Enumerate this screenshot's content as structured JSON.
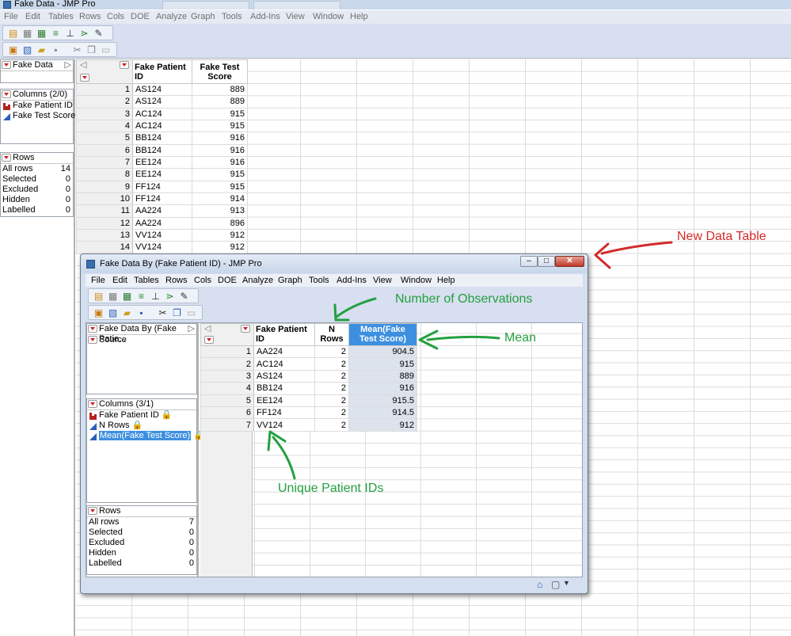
{
  "main_window": {
    "title": "Fake Data - JMP Pro",
    "menu": [
      "File",
      "Edit",
      "Tables",
      "Rows",
      "Cols",
      "DOE",
      "Analyze",
      "Graph",
      "Tools",
      "Add-Ins",
      "View",
      "Window",
      "Help"
    ],
    "table_panel_title": "Fake Data",
    "columns_panel_title": "Columns (2/0)",
    "columns": [
      {
        "name": "Fake Patient ID",
        "type": "nominal"
      },
      {
        "name": "Fake Test Score",
        "type": "continuous"
      }
    ],
    "rows_panel_title": "Rows",
    "rows_summary": [
      {
        "label": "All rows",
        "value": "14"
      },
      {
        "label": "Selected",
        "value": "0"
      },
      {
        "label": "Excluded",
        "value": "0"
      },
      {
        "label": "Hidden",
        "value": "0"
      },
      {
        "label": "Labelled",
        "value": "0"
      }
    ],
    "grid_headers": [
      "Fake Patient ID",
      "Fake Test Score"
    ],
    "grid_rows": [
      {
        "n": "1",
        "id": "AS124",
        "score": "889"
      },
      {
        "n": "2",
        "id": "AS124",
        "score": "889"
      },
      {
        "n": "3",
        "id": "AC124",
        "score": "915"
      },
      {
        "n": "4",
        "id": "AC124",
        "score": "915"
      },
      {
        "n": "5",
        "id": "BB124",
        "score": "916"
      },
      {
        "n": "6",
        "id": "BB124",
        "score": "916"
      },
      {
        "n": "7",
        "id": "EE124",
        "score": "916"
      },
      {
        "n": "8",
        "id": "EE124",
        "score": "915"
      },
      {
        "n": "9",
        "id": "FF124",
        "score": "915"
      },
      {
        "n": "10",
        "id": "FF124",
        "score": "914"
      },
      {
        "n": "11",
        "id": "AA224",
        "score": "913"
      },
      {
        "n": "12",
        "id": "AA224",
        "score": "896"
      },
      {
        "n": "13",
        "id": "VV124",
        "score": "912"
      },
      {
        "n": "14",
        "id": "VV124",
        "score": "912"
      }
    ]
  },
  "child_window": {
    "title": "Fake Data By (Fake Patient ID) - JMP Pro",
    "menu": [
      "File",
      "Edit",
      "Tables",
      "Rows",
      "Cols",
      "DOE",
      "Analyze",
      "Graph",
      "Tools",
      "Add-Ins",
      "View",
      "Window",
      "Help"
    ],
    "table_panel_title": "Fake Data By (Fake Patie...",
    "source_label": "Source",
    "columns_panel_title": "Columns (3/1)",
    "columns": [
      {
        "name": "Fake Patient ID",
        "type": "nominal"
      },
      {
        "name": "N Rows",
        "type": "continuous"
      },
      {
        "name": "Mean(Fake Test Score)",
        "type": "continuous"
      }
    ],
    "rows_panel_title": "Rows",
    "rows_summary": [
      {
        "label": "All rows",
        "value": "7"
      },
      {
        "label": "Selected",
        "value": "0"
      },
      {
        "label": "Excluded",
        "value": "0"
      },
      {
        "label": "Hidden",
        "value": "0"
      },
      {
        "label": "Labelled",
        "value": "0"
      }
    ],
    "grid_headers": [
      "Fake Patient ID",
      "N Rows",
      "Mean(Fake Test Score)"
    ],
    "grid_rows": [
      {
        "n": "1",
        "id": "AA224",
        "count": "2",
        "mean": "904.5"
      },
      {
        "n": "2",
        "id": "AC124",
        "count": "2",
        "mean": "915"
      },
      {
        "n": "3",
        "id": "AS124",
        "count": "2",
        "mean": "889"
      },
      {
        "n": "4",
        "id": "BB124",
        "count": "2",
        "mean": "916"
      },
      {
        "n": "5",
        "id": "EE124",
        "count": "2",
        "mean": "915.5"
      },
      {
        "n": "6",
        "id": "FF124",
        "count": "2",
        "mean": "914.5"
      },
      {
        "n": "7",
        "id": "VV124",
        "count": "2",
        "mean": "912"
      }
    ]
  },
  "annotations": {
    "new_data_table": "New Data Table",
    "number_of_observations": "Number of Observations",
    "mean": "Mean",
    "unique_patient_ids": "Unique Patient IDs"
  },
  "colors": {
    "annotation_red": "#d42a2a",
    "annotation_green": "#24a040",
    "selected_column": "#3d8fe0"
  }
}
